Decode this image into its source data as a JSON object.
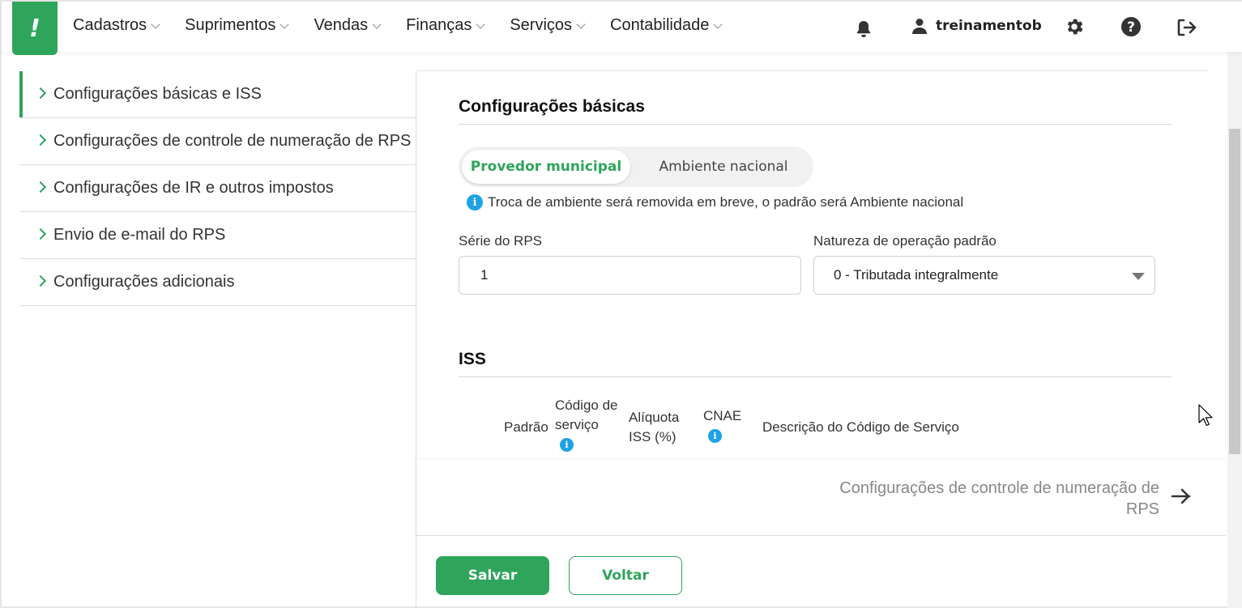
{
  "app": {
    "logo_glyph": "!",
    "brand_color": "#2ea55a"
  },
  "nav": {
    "items": [
      {
        "label": "Cadastros"
      },
      {
        "label": "Suprimentos"
      },
      {
        "label": "Vendas"
      },
      {
        "label": "Finanças"
      },
      {
        "label": "Serviços"
      },
      {
        "label": "Contabilidade"
      }
    ],
    "user": "treinamentob"
  },
  "sidebar": {
    "items": [
      {
        "label": "Configurações básicas e ISS",
        "active": true
      },
      {
        "label": "Configurações de controle de numeração de RPS"
      },
      {
        "label": "Configurações de IR e outros impostos"
      },
      {
        "label": "Envio de e-mail do RPS"
      },
      {
        "label": "Configurações adicionais"
      }
    ]
  },
  "basic": {
    "title": "Configurações básicas",
    "toggle": {
      "selected": "Provedor municipal",
      "other": "Ambiente nacional"
    },
    "info": "Troca de ambiente será removida em breve, o padrão será Ambiente nacional",
    "serie_label": "Série do RPS",
    "serie_value": "1",
    "natureza_label": "Natureza de operação padrão",
    "natureza_value": "0 - Tributada integralmente"
  },
  "iss": {
    "title": "ISS",
    "columns": {
      "padrao": "Padrão",
      "codigo_l1": "Código de",
      "codigo_l2": "serviço",
      "aliquota_l1": "Alíquota",
      "aliquota_l2": "ISS (%)",
      "cnae": "CNAE",
      "descricao": "Descrição do Código de Serviço"
    }
  },
  "next": {
    "line1": "Configurações de controle de numeração de",
    "line2": "RPS"
  },
  "actions": {
    "save": "Salvar",
    "back": "Voltar"
  }
}
